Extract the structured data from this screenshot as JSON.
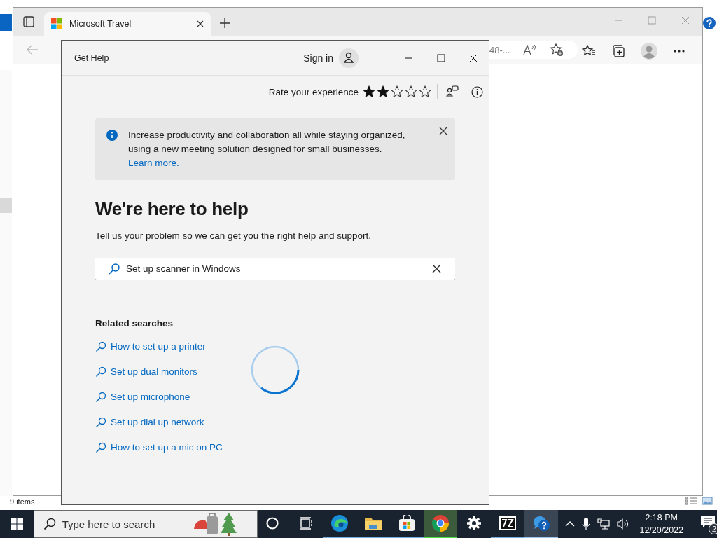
{
  "explorer": {
    "status": "9 items"
  },
  "browser": {
    "tab": {
      "title": "Microsoft Travel",
      "selected": true
    },
    "address_fragment": "48-..."
  },
  "help_window": {
    "title": "Get Help",
    "sign_in": "Sign in",
    "rating": {
      "label": "Rate your experience",
      "stars": 2
    },
    "banner": {
      "text": "Increase productivity and collaboration all while staying organized, using a new meeting solution designed for small businesses.",
      "link": "Learn more."
    },
    "heading": "We're here to help",
    "subtitle": "Tell us your problem so we can get you the right help and support.",
    "search": {
      "value": "Set up scanner in Windows"
    },
    "related": {
      "title": "Related searches",
      "items": [
        {
          "label": "How to set up a printer"
        },
        {
          "label": "Set up dual monitors"
        },
        {
          "label": "Set up microphone"
        },
        {
          "label": "Set up dial up network"
        },
        {
          "label": "How to set up a mic on PC"
        }
      ]
    },
    "loading": true
  },
  "taskbar": {
    "search": {
      "placeholder": "Type here to search"
    },
    "apps": [
      {
        "kind": "cortana",
        "open": false,
        "selected": false,
        "attention": false
      },
      {
        "kind": "taskview",
        "open": false,
        "selected": false,
        "attention": false
      },
      {
        "kind": "edge",
        "open": true,
        "selected": false,
        "attention": false
      },
      {
        "kind": "explorer",
        "open": true,
        "selected": false,
        "attention": false
      },
      {
        "kind": "store",
        "open": true,
        "selected": false,
        "attention": false
      },
      {
        "kind": "chrome",
        "open": true,
        "selected": false,
        "attention": true
      },
      {
        "kind": "settings",
        "open": false,
        "selected": false,
        "attention": false
      },
      {
        "kind": "sevenzip",
        "open": true,
        "selected": false,
        "attention": false
      },
      {
        "kind": "gethelp",
        "open": true,
        "selected": true,
        "attention": false
      }
    ],
    "time": "2:18 PM",
    "date": "12/20/2022",
    "notifications": "2"
  }
}
